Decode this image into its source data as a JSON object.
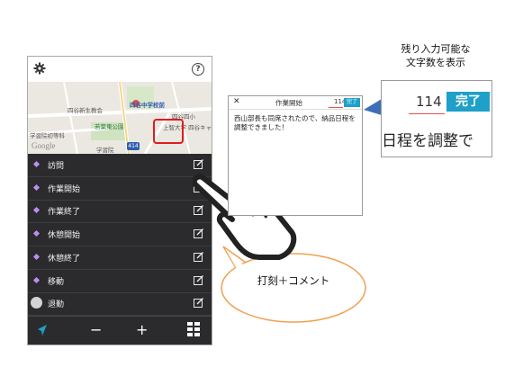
{
  "caption": {
    "line1": "残り入力可能な",
    "line2": "文字数を表示"
  },
  "map": {
    "labels": {
      "school": "四谷中学校前",
      "shinsei": "四谷新生教会",
      "high_school": "四谷四小",
      "park": "若葉東公園",
      "jochi": "上智大学 四谷キャ",
      "gakushuin": "学習院初等科",
      "gakushuin2": "学習院",
      "google": "Google",
      "route": "414"
    }
  },
  "actions": [
    {
      "label": "訪問",
      "marker": "diamond"
    },
    {
      "label": "作業開始",
      "marker": "diamond"
    },
    {
      "label": "作業終了",
      "marker": "diamond"
    },
    {
      "label": "休憩開始",
      "marker": "diamond"
    },
    {
      "label": "休憩終了",
      "marker": "diamond"
    },
    {
      "label": "移動",
      "marker": "diamond"
    },
    {
      "label": "退勤",
      "marker": "circle"
    }
  ],
  "toolbar": {
    "help": "?",
    "minus": "−",
    "plus": "+"
  },
  "dialog": {
    "close": "✕",
    "title": "作業開始",
    "count": "114",
    "done": "完了",
    "body": "西山部長も同席されたので、納品日程を調整できました！"
  },
  "zoom": {
    "count": "114",
    "done": "完了",
    "text": "日程を調整で"
  },
  "bubble": {
    "text": "打刻＋コメント"
  },
  "colors": {
    "accent": "#1ea0c8",
    "highlight": "#e21b1b",
    "list_bg": "#2b2b2d",
    "bubble_border": "#f0a050"
  }
}
